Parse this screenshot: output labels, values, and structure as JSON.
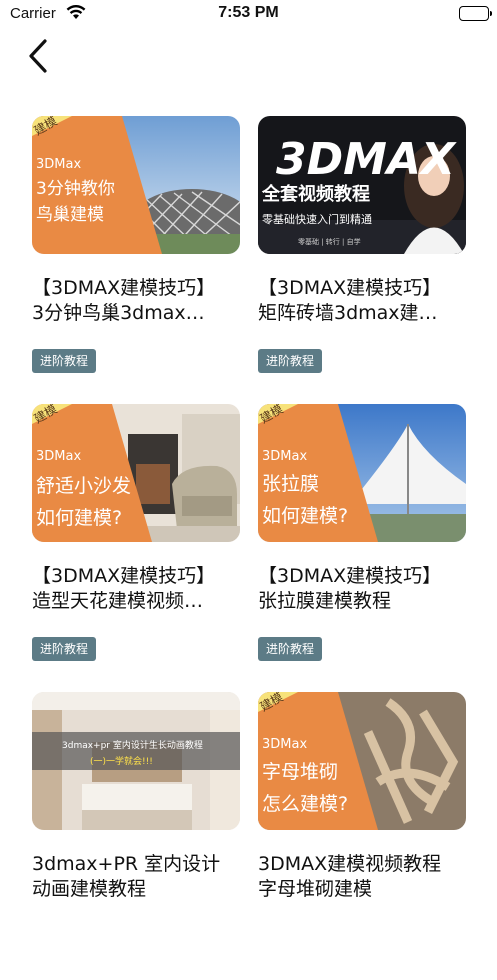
{
  "status": {
    "carrier": "Carrier",
    "time": "7:53 PM"
  },
  "cards": [
    {
      "title": "【3DMAX建模技巧】\n3分钟鸟巢3dmax…",
      "tag": "进阶教程",
      "thumb_text": {
        "corner": "建模",
        "brand": "3DMax",
        "line1": "3分钟教你",
        "line2": "鸟巢建模"
      }
    },
    {
      "title": "【3DMAX建模技巧】\n矩阵砖墙3dmax建…",
      "tag": "进阶教程",
      "thumb_text": {
        "logo": "3DMAX",
        "line1": "全套视频教程",
        "line2": "零基础快速入门到精通",
        "line3": "零基础 | 转行 | 自学"
      }
    },
    {
      "title": "【3DMAX建模技巧】\n造型天花建模视频…",
      "tag": "进阶教程",
      "thumb_text": {
        "corner": "建模",
        "brand": "3DMax",
        "line1": "舒适小沙发",
        "line2": "如何建模?"
      }
    },
    {
      "title": "【3DMAX建模技巧】\n张拉膜建模教程",
      "tag": "进阶教程",
      "thumb_text": {
        "corner": "建模",
        "brand": "3DMax",
        "line1": "张拉膜",
        "line2": "如何建模?"
      }
    },
    {
      "title": "3dmax+PR 室内设计\n动画建模教程",
      "tag": "",
      "thumb_text": {
        "line1": "3dmax+pr 室内设计生长动画教程",
        "line2": "(一)一学就会!!!"
      }
    },
    {
      "title": "3DMAX建模视频教程\n字母堆砌建模",
      "tag": "",
      "thumb_text": {
        "corner": "建模",
        "brand": "3DMax",
        "line1": "字母堆砌",
        "line2": "怎么建模?"
      }
    }
  ],
  "colors": {
    "orange": "#e98a44",
    "tag_bg": "#5c7b86",
    "yellow": "#f7e27a"
  }
}
